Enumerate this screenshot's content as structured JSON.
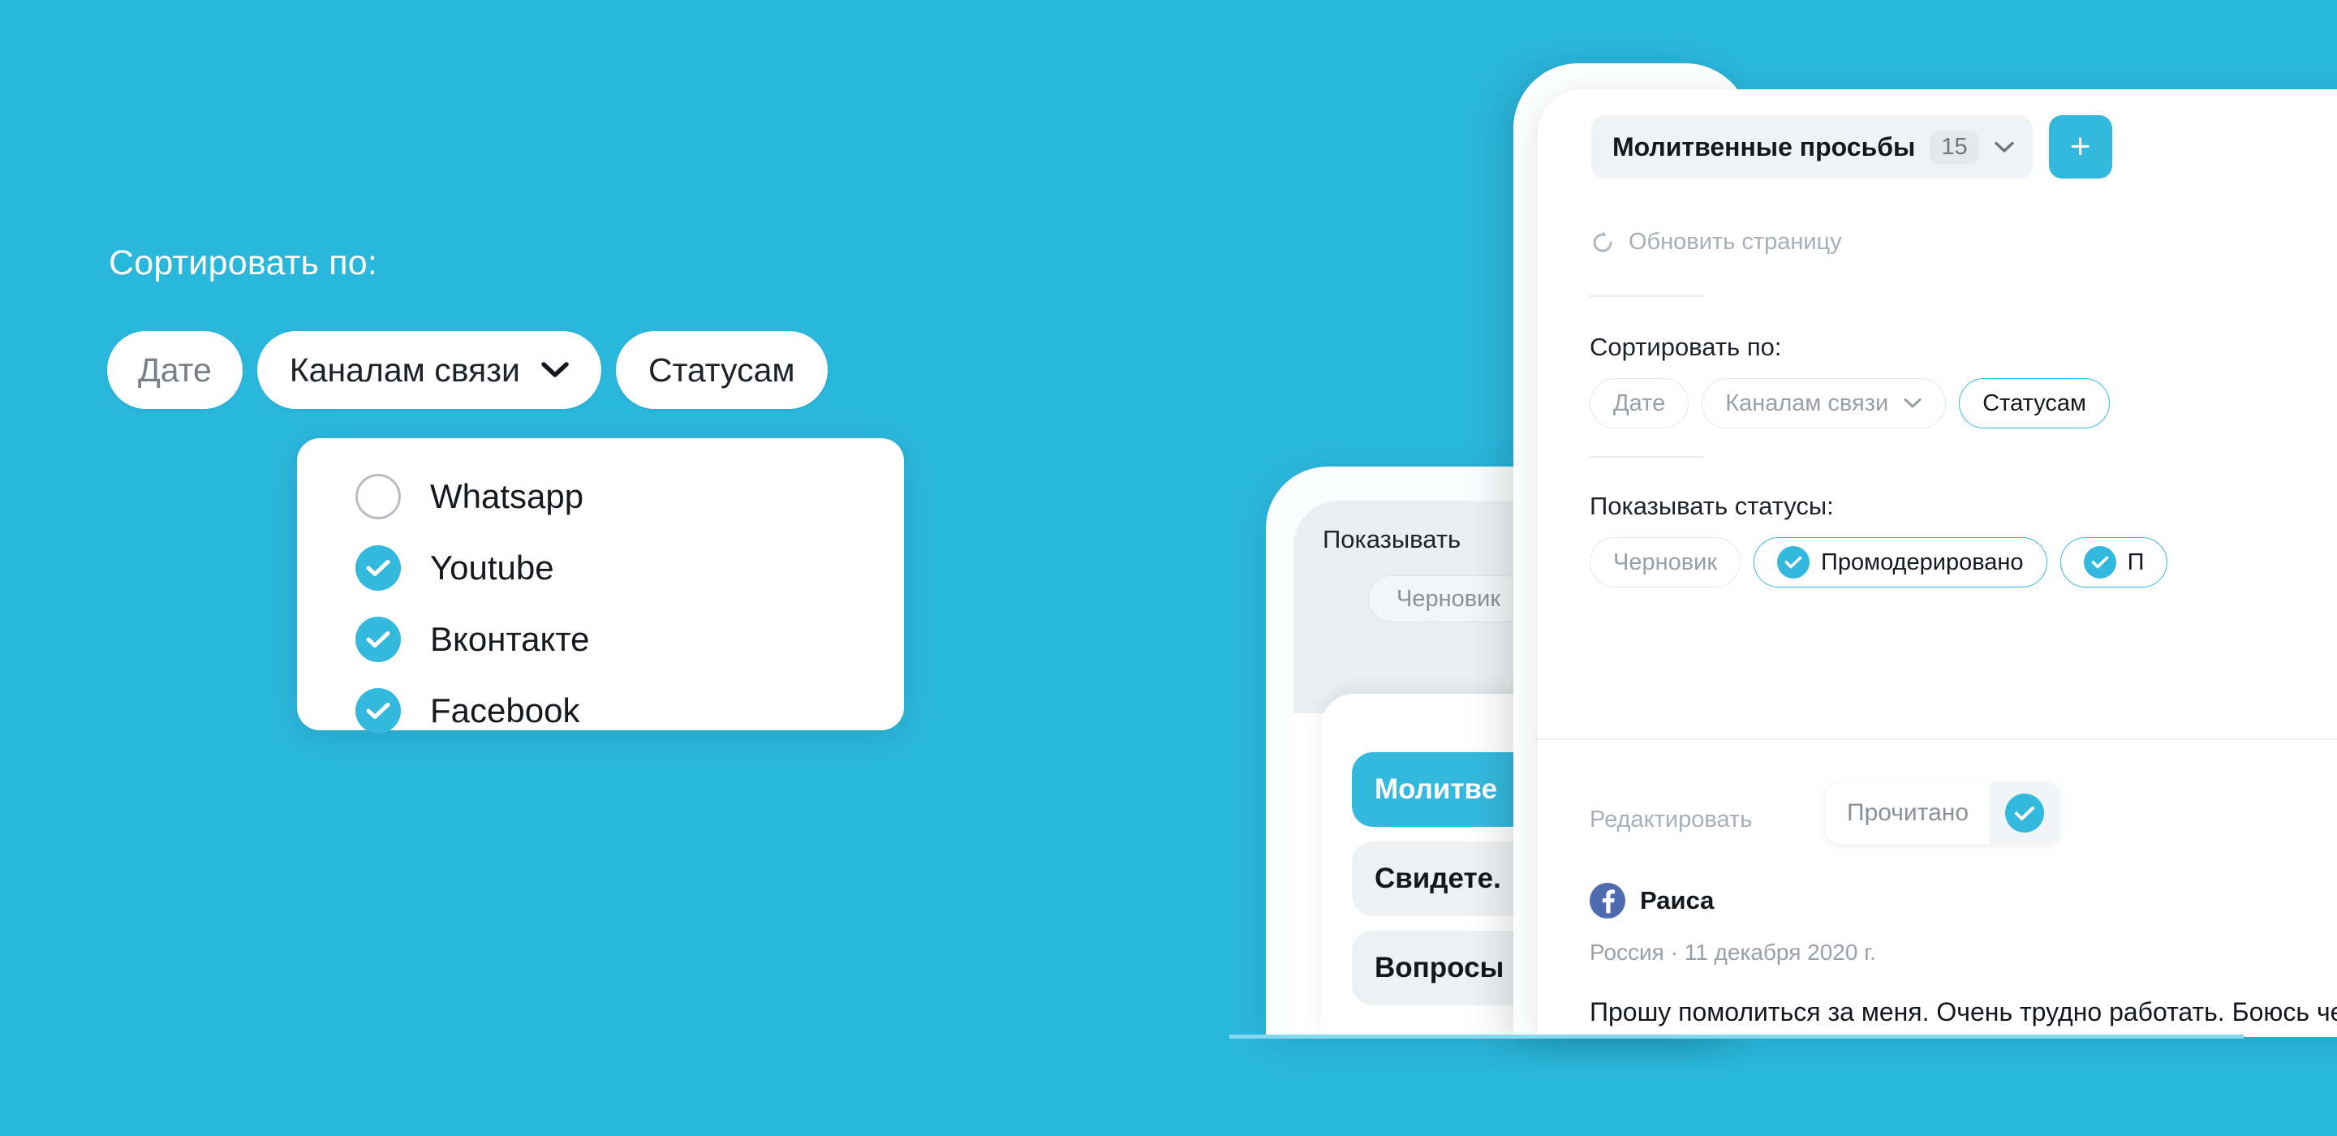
{
  "theme": {
    "background": "#2ab7dc",
    "accent": "#34b9de",
    "facebook_blue": "#4c6bb0"
  },
  "left": {
    "sort_title": "Сортировать по:",
    "chips": [
      {
        "label": "Дате",
        "state": "muted"
      },
      {
        "label": "Каналам связи",
        "state": "active",
        "icon": "chevron-down-icon"
      },
      {
        "label": "Статусам",
        "state": "default"
      }
    ],
    "dropdown": {
      "options": [
        {
          "label": "Whatsapp",
          "checked": false
        },
        {
          "label": "Youtube",
          "checked": true
        },
        {
          "label": "Вконтакте",
          "checked": true
        },
        {
          "label": "Facebook",
          "checked": true
        }
      ]
    }
  },
  "phone_back": {
    "statuses_title": "Показывать",
    "chip_label": "Черновик",
    "sheet_items": [
      {
        "label": "Молитве",
        "active": true
      },
      {
        "label": "Свидете.",
        "active": false
      },
      {
        "label": "Вопросы",
        "active": false
      }
    ]
  },
  "phone_front": {
    "category": {
      "name": "Молитвенные просьбы",
      "count": "15",
      "icon": "chevron-down-icon"
    },
    "add_button": {
      "label": "+",
      "icon": "plus-icon"
    },
    "refresh": {
      "label": "Обновить страницу",
      "icon": "refresh-icon"
    },
    "sort": {
      "title": "Сортировать по:",
      "chips": [
        {
          "label": "Дате",
          "state": "muted"
        },
        {
          "label": "Каналам связи",
          "state": "muted",
          "icon": "chevron-down-icon"
        },
        {
          "label": "Статусам",
          "state": "selected"
        }
      ]
    },
    "statuses": {
      "title": "Показывать статусы:",
      "chips": [
        {
          "label": "Черновик",
          "checked": false
        },
        {
          "label": "Промодерировано",
          "checked": true
        },
        {
          "label": "П",
          "checked": true
        }
      ]
    },
    "post": {
      "edit_label": "Редактировать",
      "read_label": "Прочитано",
      "read_checked": true,
      "source_icon": "facebook-icon",
      "author": "Раиса",
      "meta": "Россия  ·  11 декабря 2020 г.",
      "body": "Прошу помолиться за меня. Очень трудно работать. Боюсь чего-то не"
    }
  }
}
